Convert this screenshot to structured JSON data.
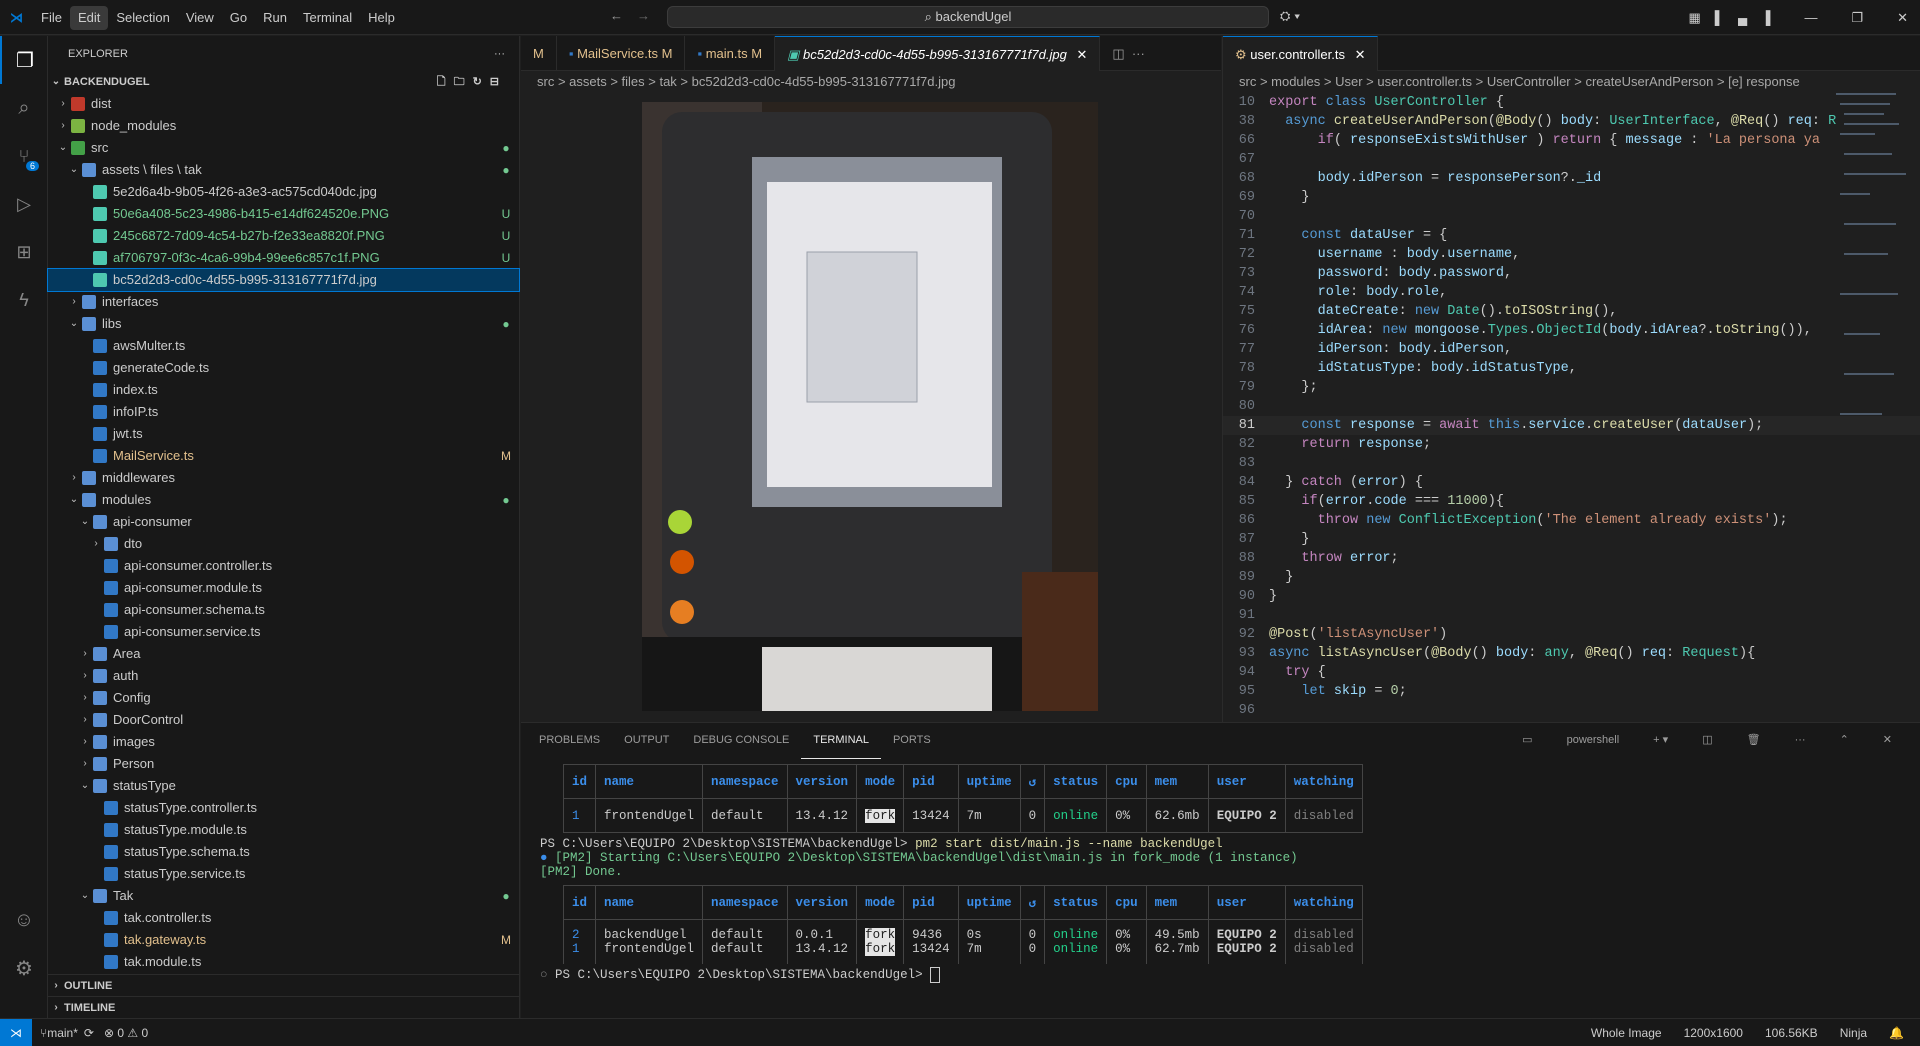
{
  "menu": [
    "File",
    "Edit",
    "Selection",
    "View",
    "Go",
    "Run",
    "Terminal",
    "Help"
  ],
  "search": "backendUgel",
  "sidebar": {
    "title": "EXPLORER",
    "root": "BACKENDUGEL",
    "items": [
      {
        "label": "dist",
        "badge": ""
      },
      {
        "label": "node_modules",
        "badge": ""
      },
      {
        "label": "src",
        "badge": "●"
      },
      {
        "label": "assets \\ files \\ tak",
        "badge": "●"
      },
      {
        "label": "5e2d6a4b-9b05-4f26-a3e3-ac575cd040dc.jpg",
        "badge": ""
      },
      {
        "label": "50e6a408-5c23-4986-b415-e14df624520e.PNG",
        "badge": "U"
      },
      {
        "label": "245c6872-7d09-4c54-b27b-f2e33ea8820f.PNG",
        "badge": "U"
      },
      {
        "label": "af706797-0f3c-4ca6-99b4-99ee6c857c1f.PNG",
        "badge": "U"
      },
      {
        "label": "bc52d2d3-cd0c-4d55-b995-313167771f7d.jpg",
        "badge": ""
      },
      {
        "label": "interfaces",
        "badge": ""
      },
      {
        "label": "libs",
        "badge": "●"
      },
      {
        "label": "awsMulter.ts",
        "badge": ""
      },
      {
        "label": "generateCode.ts",
        "badge": ""
      },
      {
        "label": "index.ts",
        "badge": ""
      },
      {
        "label": "infoIP.ts",
        "badge": ""
      },
      {
        "label": "jwt.ts",
        "badge": ""
      },
      {
        "label": "MailService.ts",
        "badge": "M"
      },
      {
        "label": "middlewares",
        "badge": ""
      },
      {
        "label": "modules",
        "badge": "●"
      },
      {
        "label": "api-consumer",
        "badge": ""
      },
      {
        "label": "dto",
        "badge": ""
      },
      {
        "label": "api-consumer.controller.ts",
        "badge": ""
      },
      {
        "label": "api-consumer.module.ts",
        "badge": ""
      },
      {
        "label": "api-consumer.schema.ts",
        "badge": ""
      },
      {
        "label": "api-consumer.service.ts",
        "badge": ""
      },
      {
        "label": "Area",
        "badge": ""
      },
      {
        "label": "auth",
        "badge": ""
      },
      {
        "label": "Config",
        "badge": ""
      },
      {
        "label": "DoorControl",
        "badge": ""
      },
      {
        "label": "images",
        "badge": ""
      },
      {
        "label": "Person",
        "badge": ""
      },
      {
        "label": "statusType",
        "badge": ""
      },
      {
        "label": "statusType.controller.ts",
        "badge": ""
      },
      {
        "label": "statusType.module.ts",
        "badge": ""
      },
      {
        "label": "statusType.schema.ts",
        "badge": ""
      },
      {
        "label": "statusType.service.ts",
        "badge": ""
      },
      {
        "label": "Tak",
        "badge": "●"
      },
      {
        "label": "tak.controller.ts",
        "badge": ""
      },
      {
        "label": "tak.gateway.ts",
        "badge": "M"
      },
      {
        "label": "tak.module.ts",
        "badge": ""
      }
    ],
    "outline": "OUTLINE",
    "timeline": "TIMELINE"
  },
  "editor1": {
    "tabs": [
      "M",
      "MailService.ts",
      "M",
      "main.ts",
      "M",
      "bc52d2d3-cd0c-4d55-b995-313167771f7d.jpg"
    ],
    "crumbs": "src > assets > files > tak > bc52d2d3-cd0c-4d55-b995-313167771f7d.jpg"
  },
  "editor2": {
    "tab": "user.controller.ts",
    "crumbs": "src > modules > User > user.controller.ts > UserController > createUserAndPerson > [e] response"
  },
  "panel": {
    "tabs": [
      "PROBLEMS",
      "OUTPUT",
      "DEBUG CONSOLE",
      "TERMINAL",
      "PORTS"
    ],
    "shell": "powershell",
    "headers": [
      "id",
      "name",
      "namespace",
      "version",
      "mode",
      "pid",
      "uptime",
      "↺",
      "status",
      "cpu",
      "mem",
      "user",
      "watching"
    ],
    "table1": [
      [
        "1",
        "frontendUgel",
        "default",
        "13.4.12",
        "fork",
        "13424",
        "7m",
        "0",
        "online",
        "0%",
        "62.6mb",
        "EQUIPO 2",
        "disabled"
      ]
    ],
    "cmd1": "PS C:\\Users\\EQUIPO 2\\Desktop\\SISTEMA\\backendUgel> ",
    "cmd1b": "pm2 start dist/main.js --name backendUgel",
    "pm2a": "[PM2] Starting C:\\Users\\EQUIPO 2\\Desktop\\SISTEMA\\backendUgel\\dist\\main.js in fork_mode (1 instance)",
    "pm2b": "[PM2] Done.",
    "table2": [
      [
        "2",
        "backendUgel",
        "default",
        "0.0.1",
        "fork",
        "9436",
        "0s",
        "0",
        "online",
        "0%",
        "49.5mb",
        "EQUIPO 2",
        "disabled"
      ],
      [
        "1",
        "frontendUgel",
        "default",
        "13.4.12",
        "fork",
        "13424",
        "7m",
        "0",
        "online",
        "0%",
        "62.7mb",
        "EQUIPO 2",
        "disabled"
      ]
    ],
    "prompt": "PS C:\\Users\\EQUIPO 2\\Desktop\\SISTEMA\\backendUgel> "
  },
  "status": {
    "branch": "main*",
    "errors": "⊗ 0 ⚠ 0",
    "whole": "Whole Image",
    "dims": "1200x1600",
    "size": "106.56KB",
    "ninja": "Ninja"
  }
}
